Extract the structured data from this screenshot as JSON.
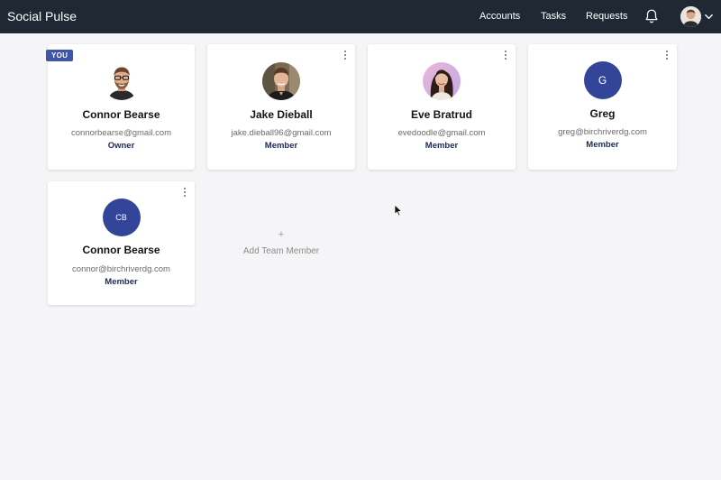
{
  "app": {
    "title": "Social Pulse"
  },
  "nav": {
    "accounts": "Accounts",
    "tasks": "Tasks",
    "requests": "Requests",
    "icons": [
      "bell-icon",
      "user-avatar",
      "chevron-down-icon"
    ]
  },
  "members": [
    {
      "name": "Connor Bearse",
      "email": "connorbearse@gmail.com",
      "role": "Owner",
      "badge": "YOU",
      "avatar": "photo"
    },
    {
      "name": "Jake Dieball",
      "email": "jake.dieball96@gmail.com",
      "role": "Member",
      "avatar": "photo"
    },
    {
      "name": "Eve Bratrud",
      "email": "evedoodle@gmail.com",
      "role": "Member",
      "avatar": "photo"
    },
    {
      "name": "Greg",
      "email": "greg@birchriverdg.com",
      "role": "Member",
      "initials": "G"
    },
    {
      "name": "Connor Bearse",
      "email": "connor@birchriverdg.com",
      "role": "Member",
      "initials": "CB"
    }
  ],
  "add_member": {
    "plus": "+",
    "label": "Add Team Member"
  },
  "colors": {
    "topbar": "#1f2833",
    "accent": "#334599",
    "role_text": "#1e2a5a"
  }
}
